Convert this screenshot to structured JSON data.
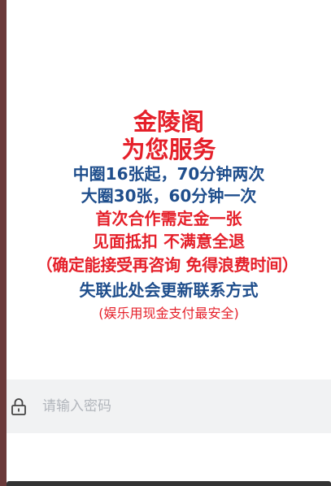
{
  "notice": {
    "title_line1": "金陵阁",
    "title_line2": "为您服务",
    "line3": "中圈16张起，70分钟两次",
    "line4": "大圈30张，60分钟一次",
    "line5": "首次合作需定金一张",
    "line6": "见面抵扣  不满意全退",
    "line7": "（确定能接受再咨询  免得浪费时间）",
    "line8": "失联此处会更新联系方式",
    "line9": "(娱乐用现金支付最安全)"
  },
  "password_field": {
    "placeholder": "请输入密码",
    "icon": "lock-icon"
  },
  "colors": {
    "red": "#e5202a",
    "blue": "#1f4e8c",
    "field_bg": "#f1f2f3",
    "placeholder": "#b2b6bc"
  }
}
